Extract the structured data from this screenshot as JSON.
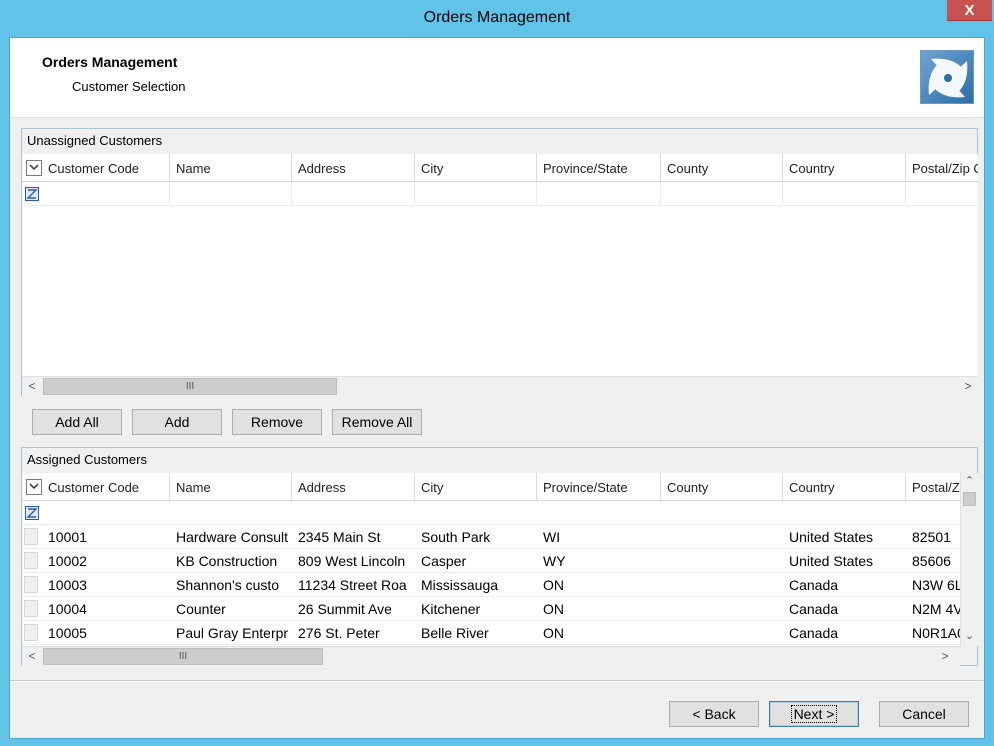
{
  "window": {
    "title": "Orders Management",
    "close_label": "X"
  },
  "header": {
    "title": "Orders Management",
    "subtitle": "Customer Selection"
  },
  "unassigned": {
    "label": "Unassigned Customers",
    "columns": [
      "Customer Code",
      "Name",
      "Address",
      "City",
      "Province/State",
      "County",
      "Country",
      "Postal/Zip C"
    ]
  },
  "assigned": {
    "label": "Assigned Customers",
    "columns": [
      "Customer Code",
      "Name",
      "Address",
      "City",
      "Province/State",
      "County",
      "Country",
      "Postal/Z"
    ],
    "rows": [
      [
        "10001",
        "Hardware Consult",
        "2345 Main St",
        "South Park",
        "WI",
        "",
        "United States",
        "82501"
      ],
      [
        "10002",
        "KB Construction",
        "809 West Lincoln",
        "Casper",
        "WY",
        "",
        "United States",
        "85606"
      ],
      [
        "10003",
        "Shannon's custo",
        "11234 Street Roa",
        "Mississauga",
        "ON",
        "",
        "Canada",
        "N3W 6L"
      ],
      [
        "10004",
        "Counter",
        "26 Summit Ave",
        "Kitchener",
        "ON",
        "",
        "Canada",
        "N2M 4V"
      ],
      [
        "10005",
        "Paul Gray Enterpr",
        "276 St. Peter",
        "Belle River",
        "ON",
        "",
        "Canada",
        "N0R1A0"
      ]
    ]
  },
  "middle_buttons": {
    "add_all": "Add All",
    "add": "Add",
    "remove": "Remove",
    "remove_all": "Remove All"
  },
  "footer_buttons": {
    "back": "< Back",
    "next": "Next >",
    "cancel": "Cancel"
  },
  "icons": {
    "column_chooser": "chevron-down-icon",
    "filter": "filter-icon",
    "logo": "app-logo-icon"
  },
  "colors": {
    "titlebar": "#62c3e9",
    "close": "#c75050",
    "accent": "#3c7fb1"
  },
  "scroll_glyph": "III"
}
